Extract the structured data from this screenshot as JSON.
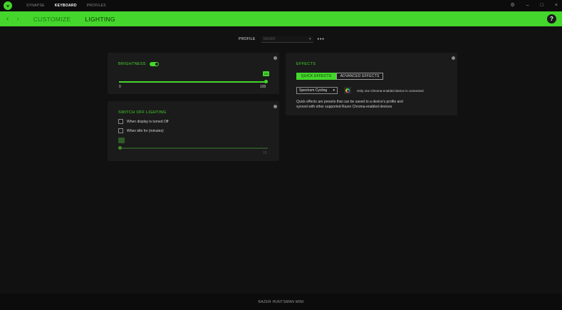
{
  "topnav": {
    "items": [
      {
        "label": "SYNAPSE",
        "active": false
      },
      {
        "label": "KEYBOARD",
        "active": true
      },
      {
        "label": "PROFILES",
        "active": false
      }
    ]
  },
  "window_controls": {
    "settings": "⚙",
    "minimize": "–",
    "maximize": "□",
    "close": "×"
  },
  "subheader": {
    "back": "‹",
    "forward": "›",
    "tabs": [
      {
        "label": "CUSTOMIZE",
        "active": false
      },
      {
        "label": "LIGHTING",
        "active": true
      }
    ],
    "help": "?"
  },
  "profile": {
    "label": "PROFILE",
    "value": "RAZER",
    "more": "•••"
  },
  "brightness": {
    "title": "BRIGHTNESS",
    "enabled": true,
    "value": 100,
    "value_label": "100",
    "min_label": "0",
    "max_label": "100"
  },
  "switch_off": {
    "title": "SWITCH OFF LIGHTING",
    "options": [
      {
        "label": "When display is turned Off",
        "checked": false
      },
      {
        "label": "When idle for (minutes)",
        "checked": false
      }
    ],
    "slider_max_label": "15"
  },
  "effects": {
    "title": "EFFECTS",
    "tabs": [
      {
        "label": "QUICK EFFECTS",
        "active": true
      },
      {
        "label": "ADVANCED EFFECTS",
        "active": false
      }
    ],
    "selected_effect": "Spectrum Cycling",
    "device_note": "Only one Chroma-enabled device is connected",
    "description_line1": "Quick effects are presets that can be saved to a device's profile and",
    "description_line2": "synced with other supported Razer Chroma-enabled devices"
  },
  "footer": {
    "device_name": "RAZER HUNTSMAN MINI"
  },
  "colors": {
    "accent": "#44d62c",
    "background": "#111111",
    "panel": "#1b1b1b"
  }
}
